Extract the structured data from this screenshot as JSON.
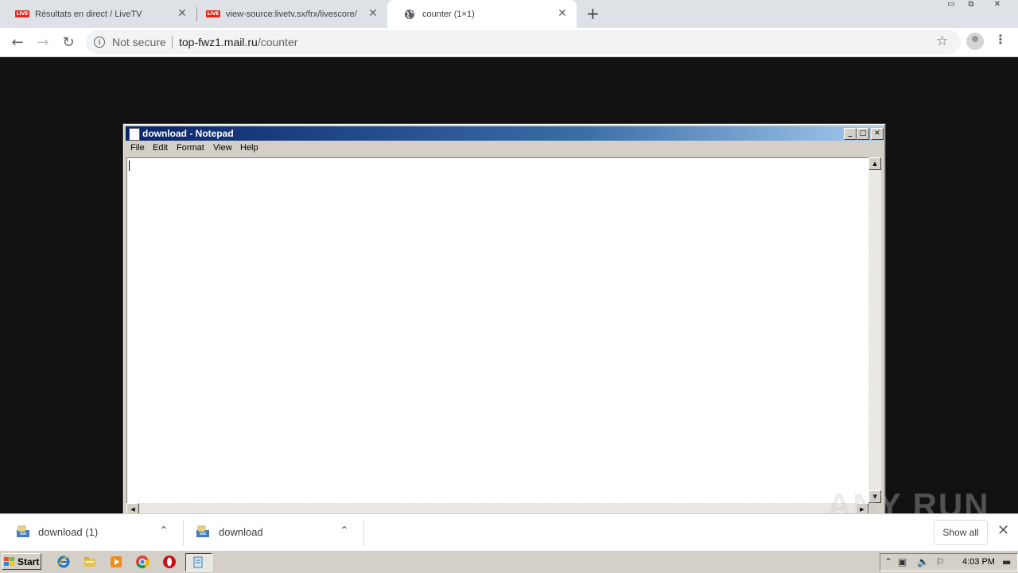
{
  "browser": {
    "tabs": [
      {
        "label": "Résultats en direct / LiveTV",
        "favicon": "live-badge",
        "active": false
      },
      {
        "label": "view-source:livetv.sx/frx/livescore/",
        "favicon": "live-badge",
        "active": false
      },
      {
        "label": "counter (1×1)",
        "favicon": "globe-icon",
        "active": true
      }
    ],
    "live_badge_text": "LIVE",
    "new_tab": "+",
    "security_text": "Not secure",
    "url_host": "top-fwz1.mail.ru",
    "url_path": "/counter"
  },
  "notepad": {
    "title": "download - Notepad",
    "menu": [
      "File",
      "Edit",
      "Format",
      "View",
      "Help"
    ],
    "content": ""
  },
  "downloads": {
    "items": [
      {
        "name": "download (1)"
      },
      {
        "name": "download"
      }
    ],
    "show_all": "Show all"
  },
  "watermark": "ANY RUN",
  "taskbar": {
    "start": "Start",
    "clock": "4:03 PM"
  },
  "colors": {
    "title_bar": "#0a246a",
    "page_bg": "#111111",
    "live_badge": "#e02b20"
  }
}
